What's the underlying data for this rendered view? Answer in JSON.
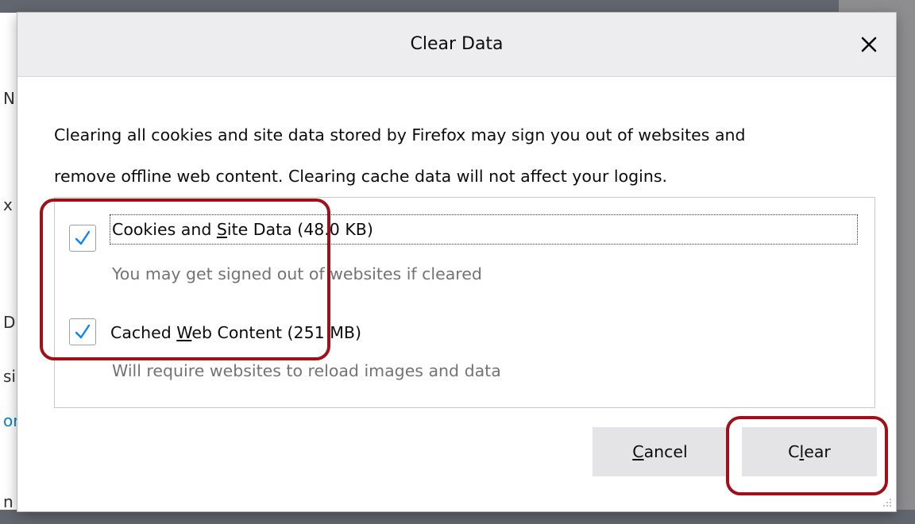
{
  "background": {
    "fragments": [
      "N",
      "x",
      "D",
      "si",
      "or",
      "n"
    ]
  },
  "dialog": {
    "title": "Clear Data",
    "close_icon": "close-icon",
    "description_line1": "Clearing all cookies and site data stored by Firefox may sign you out of websites and",
    "description_line2": "remove offline web content. Clearing cache data will not affect your logins.",
    "options": [
      {
        "label_pre": "Cookies and ",
        "label_accel": "S",
        "label_post": "ite Data (48.0 KB)",
        "checked": true,
        "sub": "You may get signed out of websites if cleared"
      },
      {
        "label_pre": "Cached ",
        "label_accel": "W",
        "label_post": "eb Content (251 MB)",
        "checked": true,
        "sub": "Will require websites to reload images and data"
      }
    ],
    "cancel_accel": "C",
    "cancel_rest": "ancel",
    "clear_pre": "C",
    "clear_accel": "l",
    "clear_post": "ear"
  },
  "colors": {
    "check": "#0a84ff",
    "annotation": "#a0101a",
    "button_bg": "#e4e4e7"
  }
}
